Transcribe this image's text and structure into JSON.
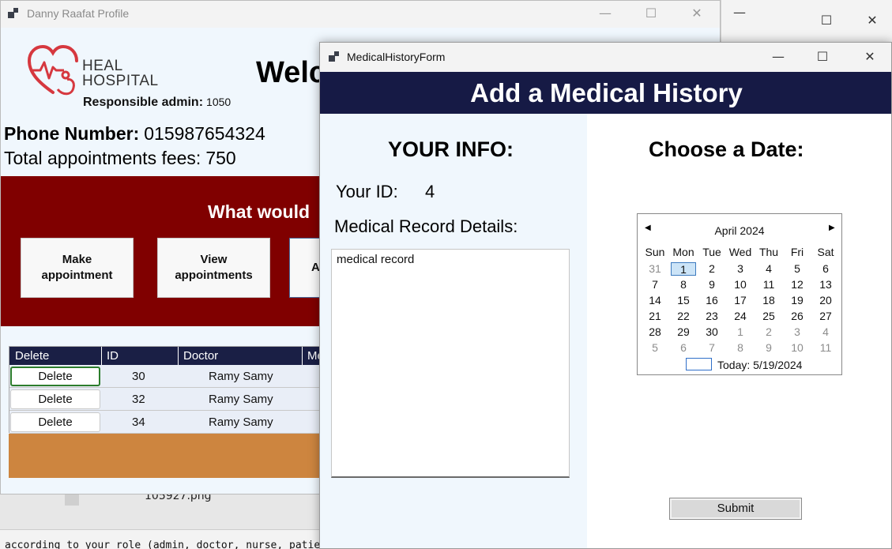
{
  "background": {
    "file_label": "105927.png",
    "file_side_text": "",
    "terminal_text": "according to your role (admin, doctor, nurse, patient)."
  },
  "profile_window": {
    "title": "Danny  Raafat Profile",
    "logo_line1": "HEAL",
    "logo_line2": "HOSPITAL",
    "admin_label": "Responsible admin:",
    "admin_value": "1050",
    "welcome": "Welc",
    "phone_label": "Phone Number:",
    "phone_value": "015987654324",
    "fees_label": "Total appointments fees:",
    "fees_value": "750",
    "question": "What would",
    "buttons": [
      "Make\nappointment",
      "View\nappointments",
      "A"
    ],
    "grid": {
      "columns": [
        "Delete",
        "ID",
        "Doctor",
        "Me"
      ],
      "rows": [
        {
          "action": "Delete",
          "id": "30",
          "doctor": "Ramy Samy"
        },
        {
          "action": "Delete",
          "id": "32",
          "doctor": "Ramy Samy"
        },
        {
          "action": "Delete",
          "id": "34",
          "doctor": "Ramy Samy"
        }
      ]
    },
    "colors": {
      "band": "#800000",
      "grid_header": "#1a1f45",
      "footer": "#cd853f"
    }
  },
  "medical_form": {
    "title": "MedicalHistoryForm",
    "banner": "Add a Medical History",
    "info_heading": "YOUR INFO:",
    "id_label": "Your ID:",
    "id_value": "4",
    "details_label": "Medical Record Details:",
    "details_value": "medical record",
    "date_heading": "Choose a Date:",
    "calendar": {
      "month": "April 2024",
      "weekdays": [
        "Sun",
        "Mon",
        "Tue",
        "Wed",
        "Thu",
        "Fri",
        "Sat"
      ],
      "weeks": [
        [
          "31",
          "1",
          "2",
          "3",
          "4",
          "5",
          "6"
        ],
        [
          "7",
          "8",
          "9",
          "10",
          "11",
          "12",
          "13"
        ],
        [
          "14",
          "15",
          "16",
          "17",
          "18",
          "19",
          "20"
        ],
        [
          "21",
          "22",
          "23",
          "24",
          "25",
          "26",
          "27"
        ],
        [
          "28",
          "29",
          "30",
          "1",
          "2",
          "3",
          "4"
        ],
        [
          "5",
          "6",
          "7",
          "8",
          "9",
          "10",
          "11"
        ]
      ],
      "selected": "1",
      "today_text": "Today: 5/19/2024"
    },
    "submit_label": "Submit",
    "colors": {
      "banner": "#161a45",
      "left_pane": "#f0f7fd"
    }
  },
  "window_controls": {
    "minimize": "—",
    "maximize": "☐",
    "close": "✕"
  }
}
